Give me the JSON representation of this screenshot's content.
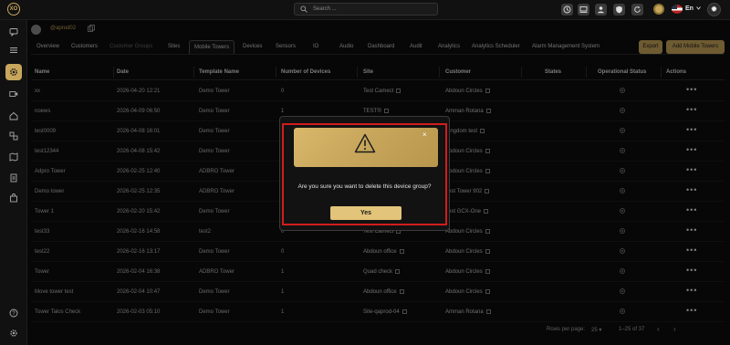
{
  "header": {
    "logo_text": "XO",
    "search_placeholder": "Search ...",
    "language": "En"
  },
  "user": {
    "name": "@aprod02"
  },
  "tabs": [
    {
      "label": "Overview",
      "state": "normal"
    },
    {
      "label": "Customers",
      "state": "normal"
    },
    {
      "label": "Customer Groups",
      "state": "muted"
    },
    {
      "label": "Sites",
      "state": "normal"
    },
    {
      "label": "Mobile Towers",
      "state": "active"
    },
    {
      "label": "Devices",
      "state": "normal"
    },
    {
      "label": "Sensors",
      "state": "normal"
    },
    {
      "label": "IO",
      "state": "normal"
    },
    {
      "label": "Audio",
      "state": "normal"
    },
    {
      "label": "Dashboard",
      "state": "normal"
    },
    {
      "label": "Audit",
      "state": "normal"
    },
    {
      "label": "Analytics",
      "state": "normal"
    },
    {
      "label": "Analytics Scheduler",
      "state": "normal"
    },
    {
      "label": "Alarm Management System",
      "state": "normal"
    }
  ],
  "actions": {
    "export_label": "Export",
    "add_label": "Add Mobile Towers"
  },
  "table": {
    "columns": [
      "Name",
      "Date",
      "Template Name",
      "Number of Devices",
      "Site",
      "Customer",
      "States",
      "Operational Status",
      "Actions"
    ],
    "rows": [
      {
        "name": "xx",
        "date": "2026-04-20 12:21",
        "template": "Demo Tower",
        "devices": "0",
        "site": "Test Camect",
        "customer": "Abdoun Circles"
      },
      {
        "name": "noews",
        "date": "2026-04-09 06:50",
        "template": "Demo Tower",
        "devices": "1",
        "site": "TEST®",
        "customer": "Amman Rotana"
      },
      {
        "name": "test0009",
        "date": "2026-04-08 16:01",
        "template": "Demo Tower",
        "devices": "",
        "site": "",
        "customer": "Kingdom test"
      },
      {
        "name": "test12344",
        "date": "2026-04-08 15:42",
        "template": "Demo Tower",
        "devices": "",
        "site": "",
        "customer": "Abdoun Circles"
      },
      {
        "name": "Adpro Tower",
        "date": "2026-02-25 12:40",
        "template": "ADBRO Tower",
        "devices": "",
        "site": "",
        "customer": "Abdoun Circles"
      },
      {
        "name": "Demo tower",
        "date": "2026-02-25 12:35",
        "template": "ADBRO Tower",
        "devices": "",
        "site": "",
        "customer": "Test Tower 902"
      },
      {
        "name": "Tower 1",
        "date": "2026-02-20 15:42",
        "template": "Demo Tower",
        "devices": "",
        "site": "",
        "customer": "Test GCX-One"
      },
      {
        "name": "test33",
        "date": "2026-02-16 14:58",
        "template": "test2",
        "devices": "0",
        "site": "Test Camect",
        "customer": "Abdoun Circles"
      },
      {
        "name": "test22",
        "date": "2026-02-16 13:17",
        "template": "Demo Tower",
        "devices": "0",
        "site": "Abdoun office",
        "customer": "Abdoun Circles"
      },
      {
        "name": "Tower",
        "date": "2026-02-04 16:38",
        "template": "ADBRO Tower",
        "devices": "1",
        "site": "Quad check",
        "customer": "Abdoun Circles"
      },
      {
        "name": "Move tower test",
        "date": "2026-02-04 10:47",
        "template": "Demo Tower",
        "devices": "1",
        "site": "Abdoun office",
        "customer": "Abdoun Circles"
      },
      {
        "name": "Tower Talos Check",
        "date": "2026-02-03 05:10",
        "template": "Demo Tower",
        "devices": "1",
        "site": "Site-qaprod-04",
        "customer": "Amman Rotana"
      }
    ]
  },
  "pagination": {
    "rows_label": "Rows per page:",
    "rows_value": "25",
    "range": "1–25 of 37"
  },
  "modal": {
    "message": "Are you sure you want to delete this device group?",
    "confirm_label": "Yes",
    "close_glyph": "×"
  },
  "colors": {
    "accent": "#c8a75c",
    "highlight": "#d11d1d",
    "background": "#0d0d0d"
  }
}
